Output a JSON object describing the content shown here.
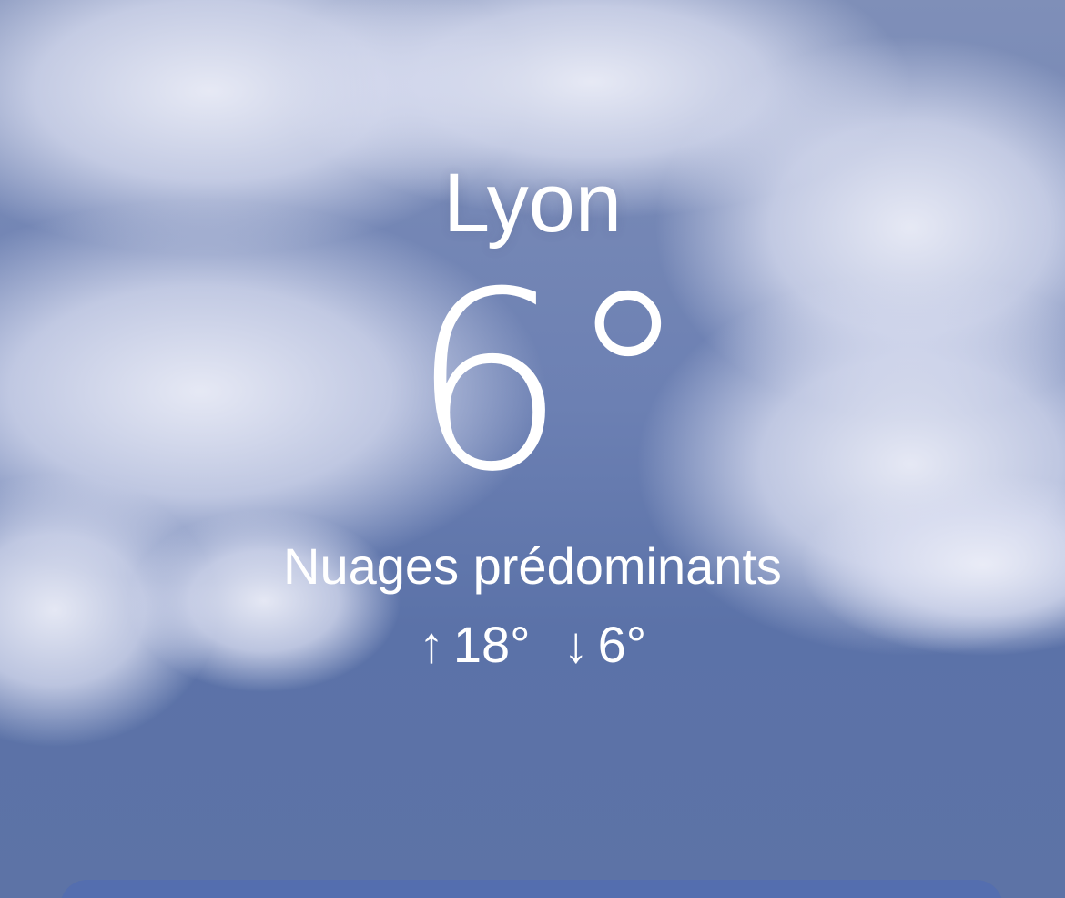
{
  "location": {
    "city": "Lyon",
    "temperature": "6°",
    "condition": "Nuages prédominants",
    "high_arrow": "↑",
    "high": "18°",
    "low_arrow": "↓",
    "low": "6°"
  },
  "colors": {
    "sky_top": "#7f8fb8",
    "sky_bottom": "#5b72a8",
    "card": "#536eaf",
    "text": "#ffffff"
  },
  "icons": {
    "high": "arrow-up-icon",
    "low": "arrow-down-icon"
  }
}
